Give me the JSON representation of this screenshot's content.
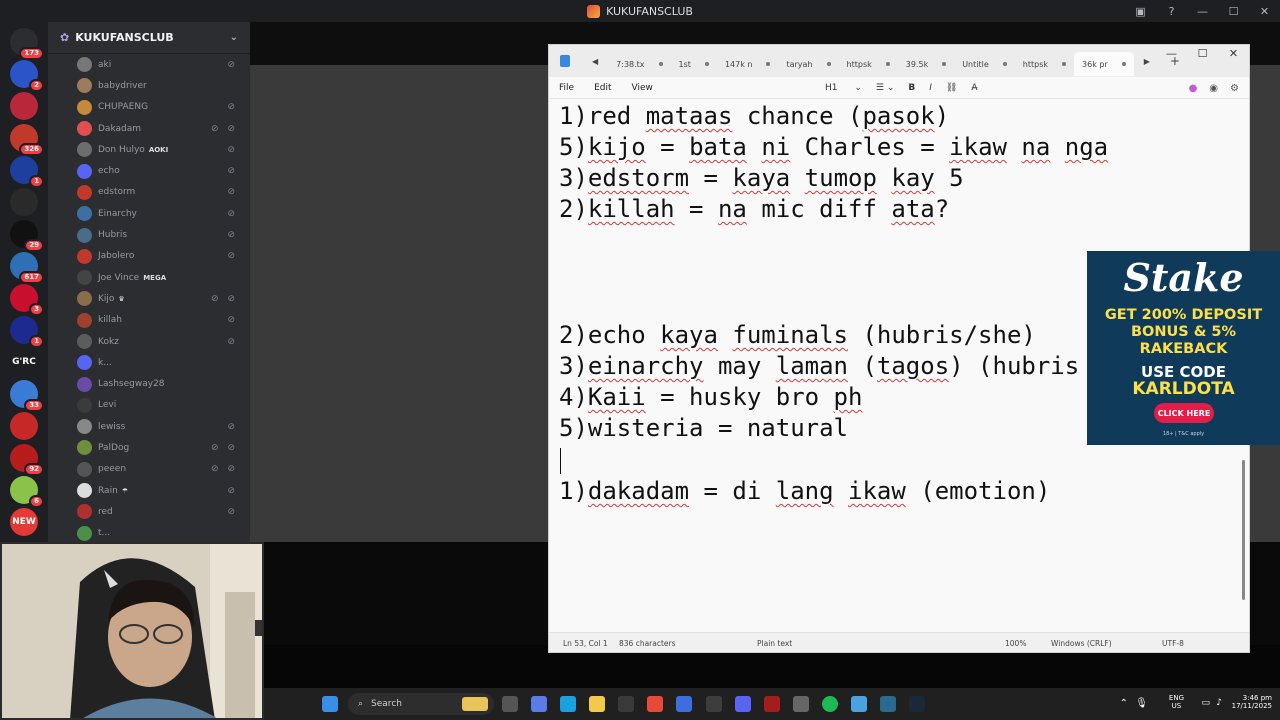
{
  "window": {
    "title": "KUKUFANSCLUB"
  },
  "rail": {
    "servers": [
      {
        "icon": "server-icon-1",
        "badge": "173",
        "color": "#2b2d31"
      },
      {
        "icon": "server-icon-2",
        "badge": "2",
        "color": "#2b54c8"
      },
      {
        "icon": "server-icon-3",
        "badge": "",
        "color": "#b8273a"
      },
      {
        "icon": "server-icon-4",
        "badge": "326",
        "color": "#c0392b"
      },
      {
        "icon": "server-icon-5",
        "badge": "1",
        "color": "#1f3f9e"
      },
      {
        "icon": "server-icon-6",
        "badge": "",
        "color": "#2a2a2a"
      },
      {
        "icon": "server-icon-7",
        "badge": "29",
        "color": "#111111"
      },
      {
        "icon": "server-icon-8",
        "badge": "617",
        "color": "#2f6fb5"
      },
      {
        "icon": "server-icon-9",
        "badge": "3",
        "color": "#c8102e"
      },
      {
        "icon": "server-icon-10",
        "badge": "1",
        "color": "#1d2a8f"
      },
      {
        "icon": "server-icon-11",
        "badge": "",
        "color": "#1e1f22",
        "label": "G'RC"
      },
      {
        "icon": "server-icon-12",
        "badge": "33",
        "color": "#3a7bd5"
      },
      {
        "icon": "server-icon-13",
        "badge": "",
        "color": "#c62828"
      },
      {
        "icon": "server-icon-14",
        "badge": "92",
        "color": "#b71c1c"
      },
      {
        "icon": "server-icon-15",
        "badge": "6",
        "color": "#8bc34a"
      },
      {
        "icon": "server-icon-16",
        "badge": "",
        "color": "#e53935",
        "label": "NEW"
      }
    ]
  },
  "sidebar": {
    "server_name": "KUKUFANSCLUB",
    "members": [
      {
        "name": "aki",
        "mic": "⊘",
        "color": "#777"
      },
      {
        "name": "babydriver",
        "mic": "",
        "color": "#9c7b5f"
      },
      {
        "name": "CHUPAENG",
        "mic": "⊘",
        "color": "#c28a3a"
      },
      {
        "name": "Dakadam",
        "mic": "⊘ ⊘",
        "color": "#e04f4f"
      },
      {
        "name": "Don Hulyo",
        "mic": "⊘",
        "color": "#6d6d6d",
        "tag": "AOKI"
      },
      {
        "name": "echo",
        "mic": "⊘",
        "color": "#5865f2"
      },
      {
        "name": "edstorm",
        "mic": "⊘",
        "color": "#c0392b"
      },
      {
        "name": "Einarchy",
        "mic": "⊘",
        "color": "#3d6fa3"
      },
      {
        "name": "Hubris",
        "mic": "⊘",
        "color": "#4a6b8a"
      },
      {
        "name": "Jabolero",
        "mic": "⊘",
        "color": "#c0392b"
      },
      {
        "name": "Joe Vince",
        "mic": "",
        "color": "#444",
        "tag": "MEGA"
      },
      {
        "name": "Kijo",
        "mic": "⊘ ⊘",
        "color": "#8a6d4a",
        "tag": "♛"
      },
      {
        "name": "killah",
        "mic": "⊘",
        "color": "#a0402e"
      },
      {
        "name": "Kokz",
        "mic": "⊘",
        "color": "#5c5c5c"
      },
      {
        "name": "k...",
        "mic": "",
        "color": "#5865f2"
      },
      {
        "name": "Lashsegway28",
        "mic": "",
        "color": "#6a4ca8"
      },
      {
        "name": "Levi",
        "mic": "",
        "color": "#3b3b3b"
      },
      {
        "name": "lewiss",
        "mic": "⊘",
        "color": "#888"
      },
      {
        "name": "PalDog",
        "mic": "⊘ ⊘",
        "color": "#6f8f3f"
      },
      {
        "name": "peeen",
        "mic": "⊘ ⊘",
        "color": "#555"
      },
      {
        "name": "Rain",
        "mic": "⊘",
        "color": "#dcdcdc",
        "tag": "☂"
      },
      {
        "name": "red",
        "mic": "⊘",
        "color": "#b03030"
      },
      {
        "name": "t...",
        "mic": "",
        "color": "#4a8f4a"
      }
    ]
  },
  "notepad": {
    "tabs": [
      {
        "label": "7:38.tx",
        "active": false
      },
      {
        "label": "1st",
        "active": false
      },
      {
        "label": "147k n",
        "active": false
      },
      {
        "label": "taryah",
        "active": false
      },
      {
        "label": "httpsk",
        "active": false
      },
      {
        "label": "39.5k",
        "active": false
      },
      {
        "label": "Untitle",
        "active": false
      },
      {
        "label": "httpsk",
        "active": false
      },
      {
        "label": "36k pr",
        "active": true
      }
    ],
    "menu": {
      "file": "File",
      "edit": "Edit",
      "view": "View"
    },
    "format": {
      "heading": "H1",
      "bold": "B",
      "italic": "I"
    },
    "lines": [
      "1)red mataas chance (pasok)",
      "5)kijo = bata ni Charles = ikaw na nga",
      "3)edstorm = kaya tumop kay 5",
      "2)killah = na mic diff ata?",
      "2)echo kaya fuminals (hubris/she)",
      "3)einarchy may laman (tagos) (hubris",
      "4)Kaii = husky bro ph",
      "5)wisteria = natural",
      "1)dakadam = di lang ikaw (emotion)"
    ],
    "status": {
      "position": "Ln 53, Col 1",
      "chars": "836 characters",
      "format": "Plain text",
      "zoom": "100%",
      "eol": "Windows (CRLF)",
      "encoding": "UTF-8"
    }
  },
  "ad": {
    "brand": "Stake",
    "headline_1": "GET 200% DEPOSIT",
    "headline_2": "BONUS & 5%",
    "headline_3": "RAKEBACK",
    "code_label": "USE CODE",
    "code": "KARLDOTA",
    "button": "CLICK HERE",
    "fine_print": "18+ | T&C apply"
  },
  "taskbar": {
    "search_placeholder": "Search",
    "lang_1": "ENG",
    "lang_2": "US",
    "time": "3:46 pm",
    "date": "17/11/2025"
  }
}
